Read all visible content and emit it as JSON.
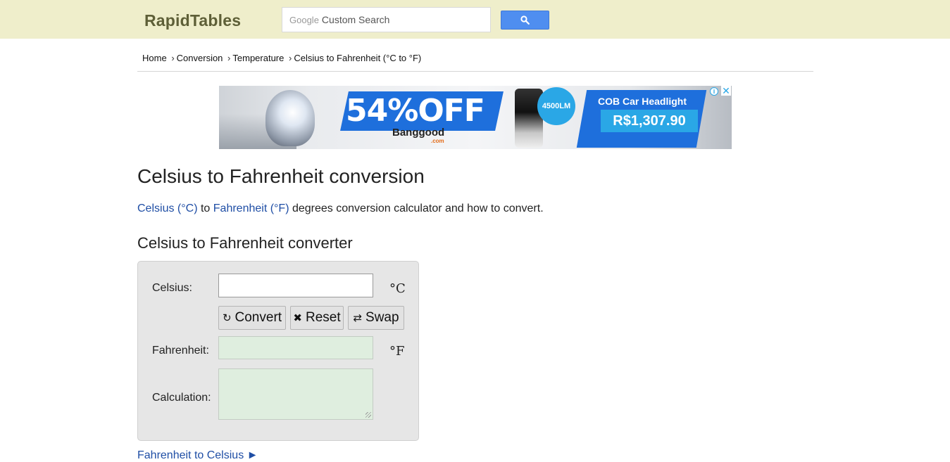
{
  "header": {
    "logo": "RapidTables",
    "search_brand": "Google",
    "search_placeholder": "Custom Search"
  },
  "breadcrumb": {
    "items": [
      "Home",
      "Conversion",
      "Temperature",
      "Celsius to Fahrenheit (°C to °F)"
    ],
    "separator": "›"
  },
  "ad": {
    "headline": "54%OFF",
    "brand": "Banggood",
    "brand_sub": ".com",
    "lumens": "4500LM",
    "product": "COB Car Headlight",
    "price": "R$1,307.90",
    "info": "i",
    "close": "✕"
  },
  "main": {
    "title": "Celsius to Fahrenheit conversion",
    "intro_link1": "Celsius (°C)",
    "intro_mid": "to",
    "intro_link2": "Fahrenheit (°F)",
    "intro_tail": "degrees conversion calculator and how to convert.",
    "section_title": "Celsius to Fahrenheit converter",
    "next_link": "Fahrenheit to Celsius ►"
  },
  "converter": {
    "celsius_label": "Celsius:",
    "celsius_value": "",
    "celsius_unit": "°C",
    "convert_label": "Convert",
    "reset_label": "Reset",
    "swap_label": "Swap",
    "fahrenheit_label": "Fahrenheit:",
    "fahrenheit_unit": "°F",
    "calculation_label": "Calculation:"
  },
  "colors": {
    "header_bg": "#efeecb",
    "logo": "#5e5f37",
    "search_button": "#4f8ef0",
    "link": "#1f4ea5",
    "output_bg": "#dfeedf",
    "panel_bg": "#e6e6e6"
  },
  "icons": {
    "search": "search-icon",
    "convert": "refresh-icon",
    "reset": "x-icon",
    "swap": "swap-icon"
  }
}
